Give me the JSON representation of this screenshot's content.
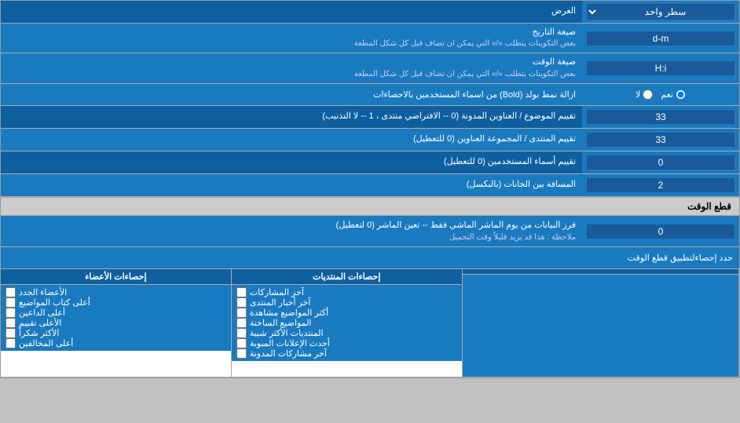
{
  "page": {
    "title": "العرض",
    "rows": [
      {
        "id": "display_mode",
        "label": "العرض",
        "input_type": "select",
        "value": "سطر واحد"
      },
      {
        "id": "date_format",
        "label": "صيغة التاريخ",
        "sublabel": "بعض التكوينات يتطلب «/» التي يمكن ان تضاف قبل كل شكل المطعة",
        "input_type": "text",
        "value": "d-m"
      },
      {
        "id": "time_format",
        "label": "صيغة الوقت",
        "sublabel": "بعض التكوينات يتطلب «/» التي يمكن ان تضاف قبل كل شكل المطعة",
        "input_type": "text",
        "value": "H:i"
      },
      {
        "id": "remove_bold",
        "label": "ازالة نمط بولد (Bold) من اسماء المستخدمين بالاحصاءات",
        "input_type": "radio",
        "options": [
          "نعم",
          "لا"
        ],
        "selected": "نعم"
      },
      {
        "id": "order_topics",
        "label": "تقييم الموضوع / العناوين المدونة (0 -- الافتراضي منتدى ، 1 -- لا التذنيب)",
        "input_type": "text",
        "value": "33"
      },
      {
        "id": "order_forum",
        "label": "تقييم المنتدى / المجموعة العناوين (0 للتعطيل)",
        "input_type": "text",
        "value": "33"
      },
      {
        "id": "order_users",
        "label": "تقييم أسماء المستخدمين (0 للتعطيل)",
        "input_type": "text",
        "value": "0"
      },
      {
        "id": "space_entries",
        "label": "المسافة بين الخانات (بالبكسل)",
        "input_type": "text",
        "value": "2"
      }
    ],
    "section_realtime": {
      "title": "قطع الوقت",
      "row": {
        "id": "realtime_fetch",
        "label": "فرز البيانات من يوم الماشر الماشي فقط -- تعين الماشر (0 لتعطيل)",
        "note": "ملاحظة : هذا قد يزيد قليلاً وقت التحميل",
        "input_type": "text",
        "value": "0"
      }
    },
    "checkbox_section": {
      "apply_label": "حدد إحصاءلتطبيق قطع الوقت",
      "col1_header": "إحصاءات المنتديات",
      "col2_header": "إحصاءات الأعضاء",
      "col1_items": [
        "آخر المشاركات",
        "آخر أخبار المنتدى",
        "أكثر المواضيع مشاهدة",
        "المواضيع الساخنة",
        "المنتديات الأكثر شبية",
        "أحدث الإعلانات المبوبة",
        "آخر مشاركات المدونة"
      ],
      "col2_items": [
        "الأعضاء الجدد",
        "أعلى كتاب المواضيع",
        "أعلى الداعين",
        "الأعلى تقييم",
        "الأكثر شكراً",
        "أعلى المخالفين"
      ]
    }
  }
}
